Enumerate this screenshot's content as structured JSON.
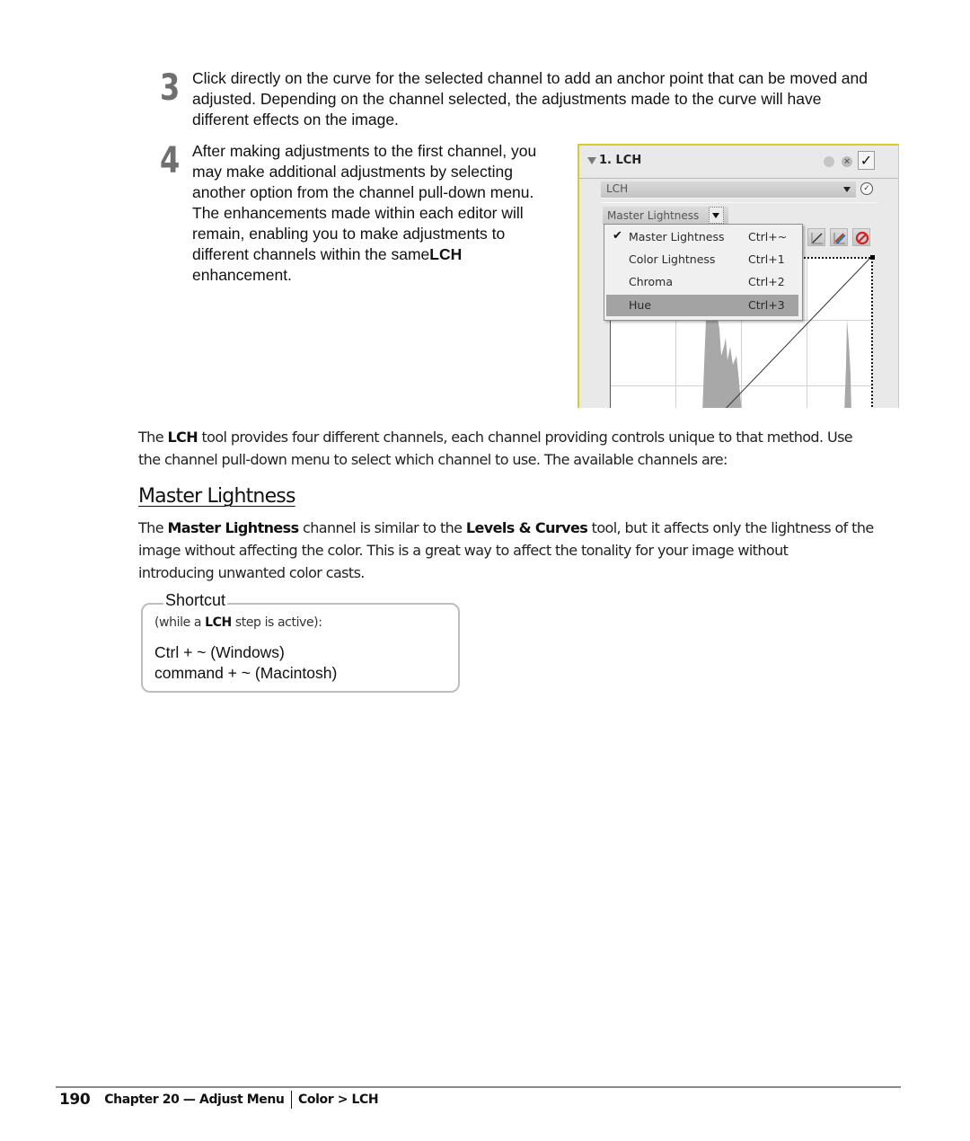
{
  "steps": [
    {
      "number": "3",
      "lines": [
        "Click directly on the curve for the selected channel to add an anchor point that can be moved and",
        "adjusted. Depending on the channel selected, the adjustments made to the curve will have",
        "different effects on the image."
      ]
    },
    {
      "number": "4",
      "lines": [
        "After making adjustments to the first channel, you",
        "may make additional adjustments by selecting",
        "another option from the channel pull-down menu.",
        "The enhancements made within each editor will",
        "remain, enabling you to make adjustments to"
      ],
      "line6_prefix": "different channels within the same",
      "line6_bold": "LCH",
      "line7": "enhancement."
    }
  ],
  "panel": {
    "title": "1. LCH",
    "preset_value": "LCH",
    "channel_value": "Master Lightness",
    "menu_items": [
      {
        "label": "Master Lightness",
        "shortcut": "Ctrl+~",
        "checked": "✔"
      },
      {
        "label": "Color Lightness",
        "shortcut": "Ctrl+1",
        "checked": ""
      },
      {
        "label": "Chroma",
        "shortcut": "Ctrl+2",
        "checked": ""
      },
      {
        "label": "Hue",
        "shortcut": "Ctrl+3",
        "checked": "",
        "highlighted": true
      }
    ],
    "tools": [
      "curve-tool",
      "color-curve-tool",
      "reset-curve-tool"
    ],
    "colors": {
      "border_accent": "#d8cc2a",
      "highlight": "#a3a3a3"
    }
  },
  "intro": {
    "p1_a": "The ",
    "p1_b": "LCH",
    "p1_c": " tool provides four different channels, each channel providing controls unique to that method. Use",
    "p1_line2": "the channel pull-down menu to select which channel to use. The available channels are:"
  },
  "section": {
    "heading": "Master Lightness",
    "p_a": "The ",
    "p_b": "Master Lightness",
    "p_c": " channel is similar to the ",
    "p_d": "Levels & Curves",
    "p_e": " tool, but it affects only the lightness of the",
    "line2": "image without affecting the color. This is a great way to affect the tonality for your image without",
    "line3": "introducing unwanted color casts."
  },
  "shortcut": {
    "title": "Shortcut",
    "note_a": "(while a ",
    "note_b": "LCH",
    "note_c": " step is active):",
    "windows": "Ctrl + ~ (Windows)",
    "mac": "command + ~ (Macintosh)"
  },
  "footer": {
    "page_number": "190",
    "chapter": "Chapter 20 — Adjust Menu",
    "section": "Color > LCH"
  }
}
